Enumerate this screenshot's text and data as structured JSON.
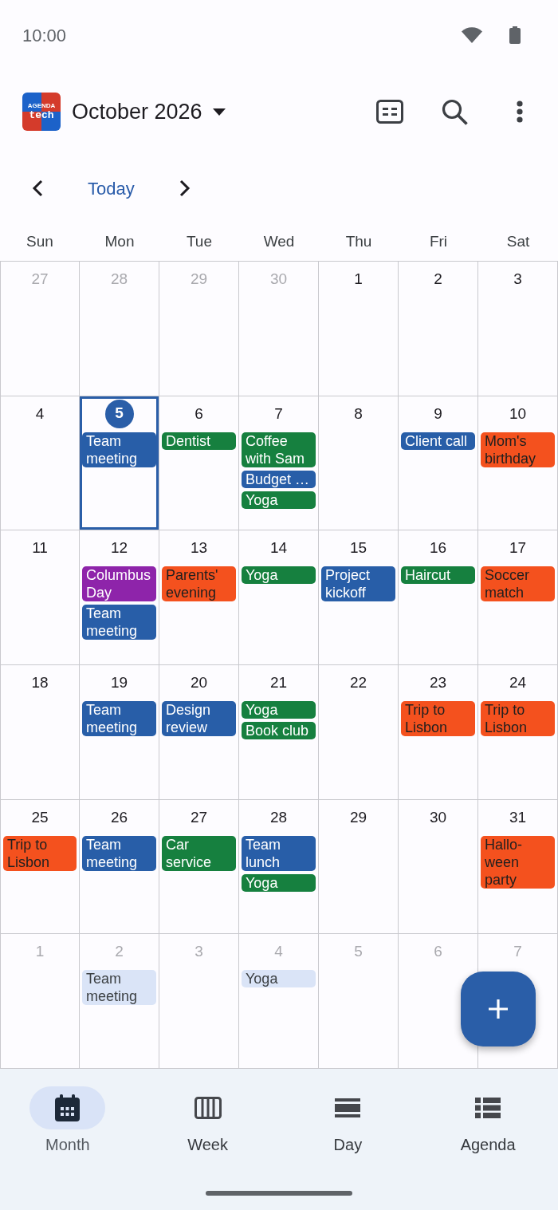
{
  "status_bar": {
    "time": "10:00"
  },
  "app_bar": {
    "logo": {
      "top_text": "AGENDA",
      "bottom_text": "tech"
    },
    "title": "October 2026"
  },
  "navigation": {
    "today": "Today"
  },
  "weekdays": [
    "Sun",
    "Mon",
    "Tue",
    "Wed",
    "Thu",
    "Fri",
    "Sat"
  ],
  "weeks": [
    {
      "days": [
        {
          "number": "27",
          "in_month": false,
          "today": false
        },
        {
          "number": "28",
          "in_month": false,
          "today": false
        },
        {
          "number": "29",
          "in_month": false,
          "today": false
        },
        {
          "number": "30",
          "in_month": false,
          "today": false
        },
        {
          "number": "1",
          "in_month": true,
          "today": false
        },
        {
          "number": "2",
          "in_month": true,
          "today": false
        },
        {
          "number": "3",
          "in_month": true,
          "today": false
        }
      ]
    },
    {
      "days": [
        {
          "number": "4",
          "in_month": true,
          "today": false
        },
        {
          "number": "5",
          "in_month": true,
          "today": true,
          "events": [
            {
              "title": "Team meeting",
              "color": "#285ea8"
            }
          ]
        },
        {
          "number": "6",
          "in_month": true,
          "today": false,
          "events": [
            {
              "title": "Dentist",
              "color": "#16803f"
            }
          ]
        },
        {
          "number": "7",
          "in_month": true,
          "today": false,
          "events": [
            {
              "title": "Coffee with Sam",
              "color": "#16803f"
            },
            {
              "title": "Budget …",
              "color": "#285ea8"
            },
            {
              "title": "Yoga",
              "color": "#16803f"
            }
          ]
        },
        {
          "number": "8",
          "in_month": true,
          "today": false
        },
        {
          "number": "9",
          "in_month": true,
          "today": false,
          "events": [
            {
              "title": "Client call",
              "color": "#285ea8"
            }
          ]
        },
        {
          "number": "10",
          "in_month": true,
          "today": false,
          "events": [
            {
              "title": "Mom's birthday",
              "color": "#f4511e"
            }
          ]
        }
      ]
    },
    {
      "days": [
        {
          "number": "11",
          "in_month": true,
          "today": false
        },
        {
          "number": "12",
          "in_month": true,
          "today": false,
          "events": [
            {
              "title": "Columbus Day",
              "color": "#8e24aa"
            },
            {
              "title": "Team meeting",
              "color": "#285ea8"
            }
          ]
        },
        {
          "number": "13",
          "in_month": true,
          "today": false,
          "events": [
            {
              "title": "Parents' evening",
              "color": "#f4511e"
            }
          ]
        },
        {
          "number": "14",
          "in_month": true,
          "today": false,
          "events": [
            {
              "title": "Yoga",
              "color": "#16803f"
            }
          ]
        },
        {
          "number": "15",
          "in_month": true,
          "today": false,
          "events": [
            {
              "title": "Project kickoff",
              "color": "#285ea8"
            }
          ]
        },
        {
          "number": "16",
          "in_month": true,
          "today": false,
          "events": [
            {
              "title": "Haircut",
              "color": "#16803f"
            }
          ]
        },
        {
          "number": "17",
          "in_month": true,
          "today": false,
          "events": [
            {
              "title": "Soccer match",
              "color": "#f4511e"
            }
          ]
        }
      ]
    },
    {
      "days": [
        {
          "number": "18",
          "in_month": true,
          "today": false
        },
        {
          "number": "19",
          "in_month": true,
          "today": false,
          "events": [
            {
              "title": "Team meeting",
              "color": "#285ea8"
            }
          ]
        },
        {
          "number": "20",
          "in_month": true,
          "today": false,
          "events": [
            {
              "title": "Design review",
              "color": "#285ea8"
            }
          ]
        },
        {
          "number": "21",
          "in_month": true,
          "today": false,
          "events": [
            {
              "title": "Yoga",
              "color": "#16803f"
            },
            {
              "title": "Book club",
              "color": "#16803f"
            }
          ]
        },
        {
          "number": "22",
          "in_month": true,
          "today": false
        },
        {
          "number": "23",
          "in_month": true,
          "today": false,
          "events": [
            {
              "title": "Trip to Lisbon",
              "color": "#f4511e"
            }
          ]
        },
        {
          "number": "24",
          "in_month": true,
          "today": false,
          "events": [
            {
              "title": "Trip to Lisbon",
              "color": "#f4511e"
            }
          ]
        }
      ]
    },
    {
      "days": [
        {
          "number": "25",
          "in_month": true,
          "today": false,
          "events": [
            {
              "title": "Trip to Lisbon",
              "color": "#f4511e"
            }
          ]
        },
        {
          "number": "26",
          "in_month": true,
          "today": false,
          "events": [
            {
              "title": "Team meeting",
              "color": "#285ea8"
            }
          ]
        },
        {
          "number": "27",
          "in_month": true,
          "today": false,
          "events": [
            {
              "title": "Car service",
              "color": "#16803f"
            }
          ]
        },
        {
          "number": "28",
          "in_month": true,
          "today": false,
          "events": [
            {
              "title": "Team lunch",
              "color": "#285ea8"
            },
            {
              "title": "Yoga",
              "color": "#16803f"
            }
          ]
        },
        {
          "number": "29",
          "in_month": true,
          "today": false
        },
        {
          "number": "30",
          "in_month": true,
          "today": false
        },
        {
          "number": "31",
          "in_month": true,
          "today": false,
          "events": [
            {
              "title": "Hallo-ween party",
              "color": "#f4511e"
            }
          ]
        }
      ]
    },
    {
      "days": [
        {
          "number": "1",
          "in_month": false,
          "today": false
        },
        {
          "number": "2",
          "in_month": false,
          "today": false,
          "events": [
            {
              "title": "Team meeting",
              "color": "#dae4f7"
            }
          ]
        },
        {
          "number": "3",
          "in_month": false,
          "today": false
        },
        {
          "number": "4",
          "in_month": false,
          "today": false,
          "events": [
            {
              "title": "Yoga",
              "color": "#dae4f7"
            }
          ]
        },
        {
          "number": "5",
          "in_month": false,
          "today": false
        },
        {
          "number": "6",
          "in_month": false,
          "today": false
        },
        {
          "number": "7",
          "in_month": false,
          "today": false
        }
      ]
    }
  ],
  "bottom_nav": [
    {
      "label": "Month",
      "selected": true
    },
    {
      "label": "Week",
      "selected": false
    },
    {
      "label": "Day",
      "selected": false
    },
    {
      "label": "Agenda",
      "selected": false
    }
  ]
}
